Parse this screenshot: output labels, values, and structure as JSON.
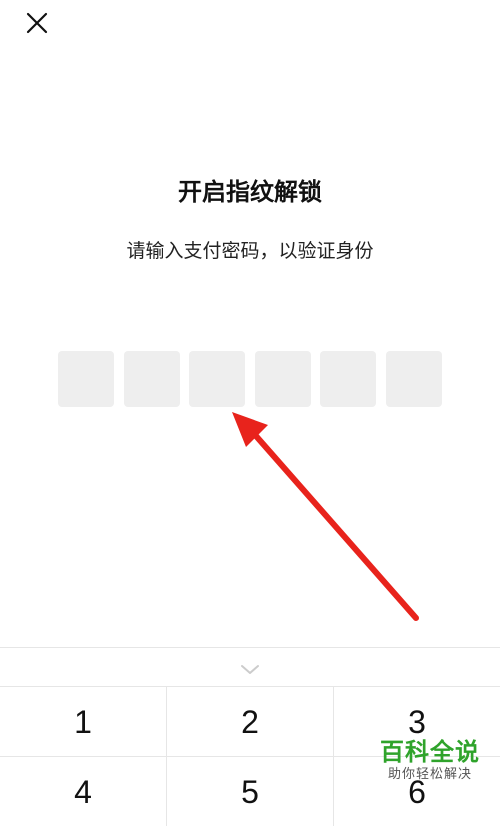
{
  "header": {
    "close_icon": "close-icon"
  },
  "main": {
    "title": "开启指纹解锁",
    "subtitle": "请输入支付密码，以验证身份",
    "pin_length": 6
  },
  "keyboard": {
    "collapse_icon": "chevron-down-icon",
    "keys": [
      "1",
      "2",
      "3",
      "4",
      "5",
      "6"
    ]
  },
  "overlay": {
    "arrow_color": "#e8231c"
  },
  "watermark": {
    "main": "百科全说",
    "sub": "助你轻松解决",
    "color": "#2fa32b"
  }
}
